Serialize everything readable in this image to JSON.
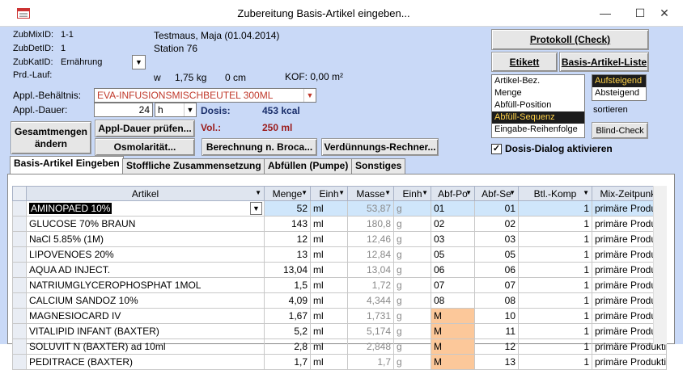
{
  "window": {
    "title": "Zubereitung Basis-Artikel eingeben...",
    "minimize": "—",
    "maximize": "☐",
    "close": "✕"
  },
  "header": {
    "zubmixid_label": "ZubMixID:",
    "zubmixid_value": "1-1",
    "zubdetid_label": "ZubDetID:",
    "zubdetid_value": "1",
    "zubkatid_label": "ZubKatID:",
    "zubkatid_value": "Ernährung",
    "prdlauf_label": "Prd.-Lauf:",
    "patient_name": "Testmaus, Maja (01.04.2014)",
    "station": "Station 76",
    "w_label": "w",
    "weight": "1,75 kg",
    "height": "0 cm",
    "kof": "KOF: 0,00 m²"
  },
  "form": {
    "behaeltnis_label": "Appl.-Behältnis:",
    "behaeltnis_value": "EVA-INFUSIONSMISCHBEUTEL 300ML",
    "dauer_label": "Appl.-Dauer:",
    "dauer_value": "24",
    "dauer_unit": "h",
    "dosis_label": "Dosis:",
    "dosis_value": "453 kcal",
    "vol_label": "Vol.:",
    "vol_value": "250 ml"
  },
  "buttons": {
    "gesamtmengen": "Gesamtmengen ändern",
    "appl_dauer_pruefen": "Appl-Dauer prüfen...",
    "osmolaritaet": "Osmolarität...",
    "berechnung_broca": "Berechnung n. Broca...",
    "verduennungs_rechner": "Verdünnungs-Rechner...",
    "protokoll": "Protokoll (Check)",
    "etikett": "Etikett",
    "basis_artikel_liste": "Basis-Artikel-Liste",
    "blind_check": "Blind-Check"
  },
  "sort": {
    "fields": [
      "Artikel-Bez.",
      "Menge",
      "Abfüll-Position",
      "Abfüll-Sequenz",
      "Eingabe-Reihenfolge"
    ],
    "selected_field": 3,
    "orders": [
      "Aufsteigend",
      "Absteigend"
    ],
    "selected_order": 0,
    "sortieren_label": "sortieren"
  },
  "dosis_dialog": {
    "checked_mark": "✓",
    "label": "Dosis-Dialog aktivieren"
  },
  "tabs": [
    "Basis-Artikel Eingeben",
    "Stoffliche Zusammensetzung",
    "Abfüllen (Pumpe)",
    "Sonstiges"
  ],
  "table": {
    "columns": [
      "Artikel",
      "Menge",
      "Einh",
      "Masse",
      "Einh",
      "Abf-Po",
      "Abf-Se",
      "Btl.-Komp",
      "Mix-Zeitpunkt"
    ],
    "rows": [
      [
        "AMINOPAED 10%",
        "52",
        "ml",
        "53,87",
        "g",
        "01",
        "01",
        "1",
        "primäre Produkti"
      ],
      [
        "GLUCOSE 70% BRAUN",
        "143",
        "ml",
        "180,8",
        "g",
        "02",
        "02",
        "1",
        "primäre Produkti"
      ],
      [
        "NaCl 5.85% (1M)",
        "12",
        "ml",
        "12,46",
        "g",
        "03",
        "03",
        "1",
        "primäre Produkti"
      ],
      [
        "LIPOVENOES 20%",
        "13",
        "ml",
        "12,84",
        "g",
        "05",
        "05",
        "1",
        "primäre Produkti"
      ],
      [
        "AQUA AD INJECT.",
        "13,04",
        "ml",
        "13,04",
        "g",
        "06",
        "06",
        "1",
        "primäre Produkti"
      ],
      [
        "NATRIUMGLYCEROPHOSPHAT 1MOL",
        "1,5",
        "ml",
        "1,72",
        "g",
        "07",
        "07",
        "1",
        "primäre Produkti"
      ],
      [
        "CALCIUM SANDOZ 10%",
        "4,09",
        "ml",
        "4,344",
        "g",
        "08",
        "08",
        "1",
        "primäre Produkti"
      ],
      [
        "MAGNESIOCARD IV",
        "1,67",
        "ml",
        "1,731",
        "g",
        "M",
        "10",
        "1",
        "primäre Produkti"
      ],
      [
        "VITALIPID INFANT (BAXTER)",
        "5,2",
        "ml",
        "5,174",
        "g",
        "M",
        "11",
        "1",
        "primäre Produkti"
      ],
      [
        "SOLUVIT N (BAXTER) ad 10ml",
        "2,8",
        "ml",
        "2,848",
        "g",
        "M",
        "12",
        "1",
        "primäre Produkti"
      ],
      [
        "PEDITRACE (BAXTER)",
        "1,7",
        "ml",
        "1,7",
        "g",
        "M",
        "13",
        "1",
        "primäre Produkti"
      ]
    ]
  },
  "colors": {
    "form_background": "#c9d9f7",
    "highlight_orange": "#fcc89a",
    "dosis_value": "#1a2f6b",
    "vol_value": "#9b1c1c",
    "combo_text": "#c0392b"
  }
}
